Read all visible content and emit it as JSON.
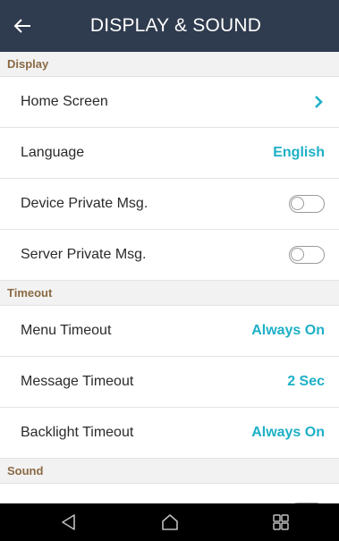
{
  "header": {
    "title": "DISPLAY & SOUND",
    "back_icon": "arrow-left-icon"
  },
  "sections": {
    "display": {
      "title": "Display",
      "home_screen": {
        "label": "Home Screen",
        "icon": "chevron-right-icon"
      },
      "language": {
        "label": "Language",
        "value": "English"
      },
      "device_private_msg": {
        "label": "Device Private Msg.",
        "enabled": false
      },
      "server_private_msg": {
        "label": "Server Private Msg.",
        "enabled": false
      }
    },
    "timeout": {
      "title": "Timeout",
      "menu_timeout": {
        "label": "Menu Timeout",
        "value": "Always On"
      },
      "message_timeout": {
        "label": "Message Timeout",
        "value": "2 Sec"
      },
      "backlight_timeout": {
        "label": "Backlight Timeout",
        "value": "Always On"
      }
    },
    "sound": {
      "title": "Sound",
      "partial_row": {
        "enabled": false
      }
    }
  },
  "navbar": {
    "back_icon": "triangle-back-icon",
    "home_icon": "home-icon",
    "recent_icon": "recent-apps-icon"
  },
  "colors": {
    "header_bg": "#2f3b4e",
    "accent": "#1eb0c6",
    "section_text": "#8a6a44",
    "navbar_bg": "#000000"
  }
}
